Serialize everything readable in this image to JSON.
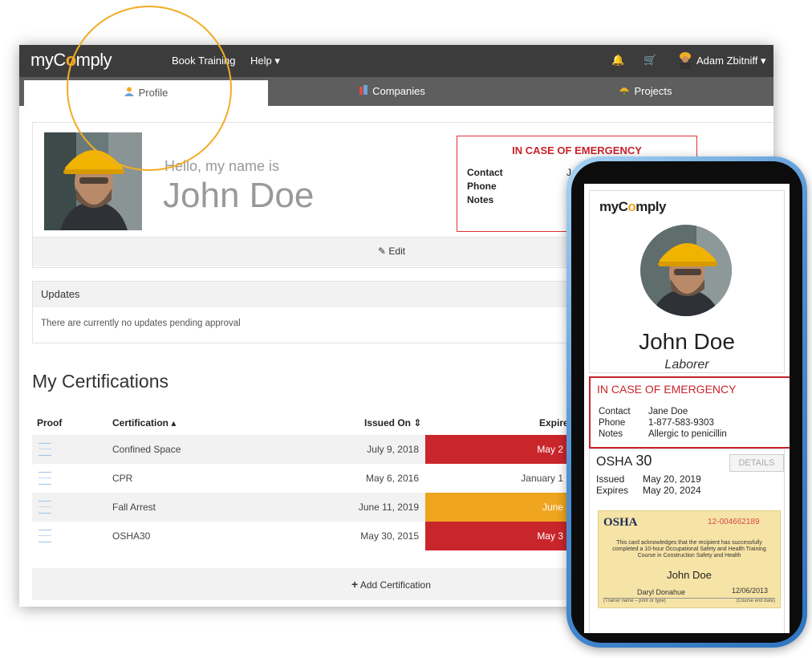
{
  "app": {
    "brand_prefix": "myC",
    "brand_o": "o",
    "brand_suffix": "mply"
  },
  "navbar": {
    "book_training": "Book Training",
    "help": "Help ▾",
    "bell": "🔔",
    "cart": "🛒",
    "user": "Adam Zbitniff ▾"
  },
  "tabs": [
    {
      "label": "Profile",
      "icon": "person-icon"
    },
    {
      "label": "Companies",
      "icon": "building-icon"
    },
    {
      "label": "Projects",
      "icon": "hardhat-icon"
    }
  ],
  "profile": {
    "hello": "Hello, my name is",
    "name": "John Doe",
    "edit": "Edit"
  },
  "emergency": {
    "title": "IN CASE OF EMERGENCY",
    "contact_label": "Contact",
    "phone_label": "Phone",
    "notes_label": "Notes",
    "contact_value": "Ja"
  },
  "updates": {
    "title": "Updates",
    "message": "There are currently no updates pending approval"
  },
  "certifications": {
    "title": "My Certifications",
    "headers": {
      "proof": "Proof",
      "certification": "Certification ▴",
      "issued": "Issued On ⇕",
      "expires": "Expire"
    },
    "rows": [
      {
        "name": "Confined Space",
        "issued": "July 9, 2018",
        "expires": "May 2",
        "status": "red"
      },
      {
        "name": "CPR",
        "issued": "May 6, 2016",
        "expires": "January 1",
        "status": "none"
      },
      {
        "name": "Fall Arrest",
        "issued": "June 11, 2019",
        "expires": "June",
        "status": "orange"
      },
      {
        "name": "OSHA30",
        "issued": "May 30, 2015",
        "expires": "May 3",
        "status": "red"
      }
    ],
    "add": "Add Certification"
  },
  "phone": {
    "logo_prefix": "myC",
    "logo_o": "o",
    "logo_suffix": "mply",
    "name": "John Doe",
    "role": "Laborer",
    "emergency": {
      "title": "IN CASE OF EMERGENCY",
      "contact_label": "Contact",
      "contact": "Jane Doe",
      "phone_label": "Phone",
      "phone": "1-877-583-9303",
      "notes_label": "Notes",
      "notes": "Allergic to penicillin"
    },
    "osha": {
      "title": "OSHA",
      "number": "30",
      "details": "DETAILS",
      "issued_label": "Issued",
      "issued": "May 20, 2019",
      "expires_label": "Expires",
      "expires": "May 20, 2024"
    },
    "card": {
      "logo": "OSHA",
      "number": "12-004662189",
      "text": "This card acknowledges that the recipient has successfully completed a 10-hour Occupational Safety and Health Training Course in Construction Safety and Health",
      "name": "John Doe",
      "trainer": "Daryl Donahue",
      "date": "12/06/2013",
      "trainer_label": "(Trainer name – print or type)",
      "date_label": "(Course end date)"
    }
  },
  "colors": {
    "accent": "#f0ad25",
    "expired": "#c9262c",
    "warning": "#efa51f",
    "navbar": "#3c3c3c"
  }
}
